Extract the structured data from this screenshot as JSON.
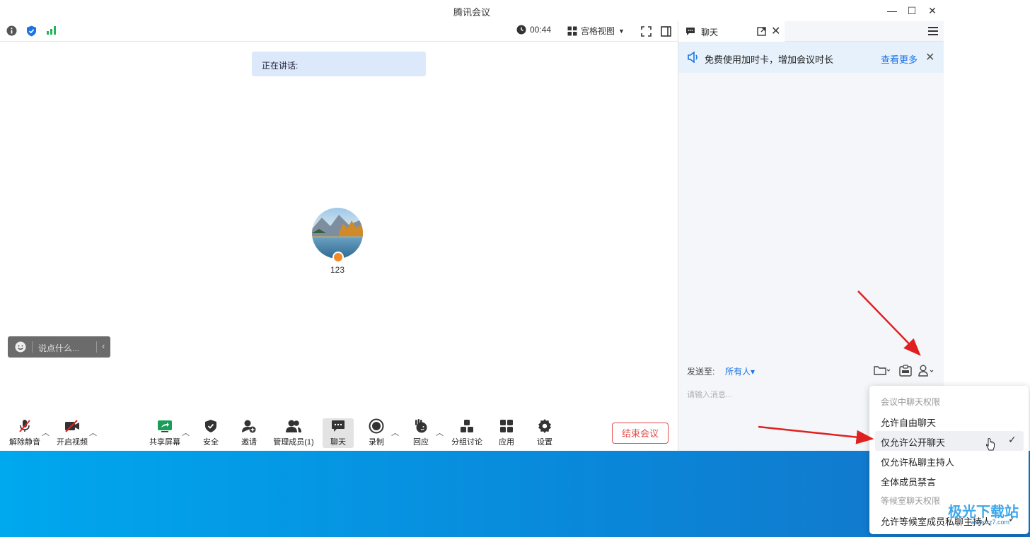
{
  "window": {
    "title": "腾讯会议"
  },
  "topbar": {
    "timer": "00:44",
    "view_label": "宫格视图"
  },
  "speaking": {
    "label": "正在讲话:"
  },
  "participant": {
    "name": "123"
  },
  "reaction_bar": {
    "placeholder": "说点什么..."
  },
  "toolbar": {
    "unmute": "解除静音",
    "start_video": "开启视频",
    "share_screen": "共享屏幕",
    "security": "安全",
    "invite": "邀请",
    "members": "管理成员(1)",
    "chat": "聊天",
    "record": "录制",
    "reactions": "回应",
    "breakout": "分组讨论",
    "apps": "应用",
    "settings": "设置",
    "end_meeting": "结束会议"
  },
  "chat_panel": {
    "tab_label": "聊天",
    "promo_text": "免费使用加时卡，增加会议时长",
    "promo_link": "查看更多",
    "send_to_label": "发送至:",
    "send_to_value": "所有人▾",
    "input_placeholder": "请输入消息..."
  },
  "permission_menu": {
    "group1": "会议中聊天权限",
    "opt1": "允许自由聊天",
    "opt2": "仅允许公开聊天",
    "opt3": "仅允许私聊主持人",
    "opt4": "全体成员禁言",
    "group2": "等候室聊天权限",
    "opt5": "允许等候室成员私聊主持人"
  },
  "watermark": {
    "main": "极光下载站",
    "sub": "www.xz7.com"
  },
  "colors": {
    "accent": "#1a73e8",
    "end_red": "#e24b4b",
    "arrow_red": "#e02020",
    "desktop_blue": "#0a86d8"
  }
}
